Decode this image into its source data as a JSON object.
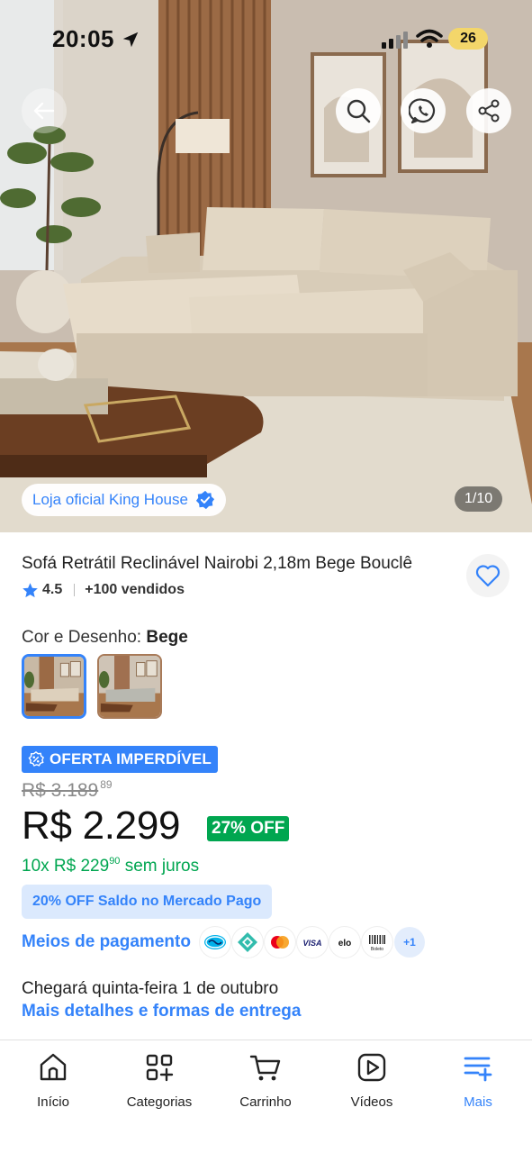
{
  "status_bar": {
    "time": "20:05",
    "battery": "26"
  },
  "gallery": {
    "store_label": "Loja oficial King House",
    "counter": "1/10"
  },
  "product": {
    "title": "Sofá Retrátil Reclinável Nairobi 2,18m Bege Bouclê",
    "rating": "4.5",
    "sold": "+100 vendidos"
  },
  "variant": {
    "label": "Cor e Desenho:",
    "value": "Bege"
  },
  "pricing": {
    "deal_badge": "OFERTA IMPERDÍVEL",
    "old_price": "R$ 3.189",
    "old_cents": "89",
    "price": "R$ 2.299",
    "discount": "27% OFF",
    "installments_prefix": "10x R$ 229",
    "installments_cents": "90",
    "installments_suffix": "sem juros",
    "mp_offer": "20% OFF Saldo no Mercado Pago"
  },
  "payment": {
    "link": "Meios de pagamento",
    "methods": [
      "mercado-pago-icon",
      "pix-icon",
      "mastercard-icon",
      "visa-icon",
      "elo-icon",
      "boleto-icon"
    ],
    "visa_text": "VISA",
    "elo_text": "elo",
    "boleto_text": "Boleto",
    "more": "+1"
  },
  "delivery": {
    "text": "Chegará quinta-feira 1 de outubro",
    "link": "Mais detalhes e formas de entrega"
  },
  "nav": {
    "items": [
      {
        "label": "Início",
        "icon": "home-icon"
      },
      {
        "label": "Categorias",
        "icon": "categories-icon"
      },
      {
        "label": "Carrinho",
        "icon": "cart-icon"
      },
      {
        "label": "Vídeos",
        "icon": "videos-icon"
      },
      {
        "label": "Mais",
        "icon": "more-menu-icon"
      }
    ],
    "active": "Mais"
  },
  "colors": {
    "accent": "#3483fa",
    "green": "#00a650",
    "mp_pill_bg": "#dbe9fd"
  }
}
